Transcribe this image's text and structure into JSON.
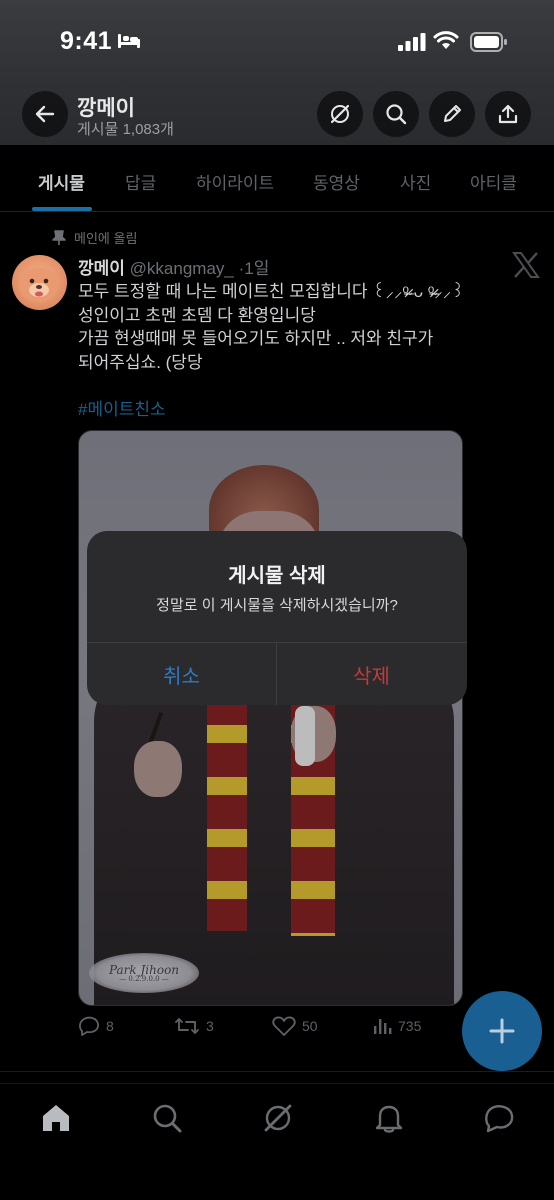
{
  "status_bar": {
    "time": "9:41"
  },
  "header": {
    "profile_name": "깡메이",
    "post_count": "게시물 1,083개"
  },
  "tabs": [
    {
      "label": "게시물",
      "active": true
    },
    {
      "label": "답글",
      "active": false
    },
    {
      "label": "하이라이트",
      "active": false
    },
    {
      "label": "동영상",
      "active": false
    },
    {
      "label": "사진",
      "active": false
    },
    {
      "label": "아티클",
      "active": false
    }
  ],
  "tweet": {
    "pinned_label": "메인에 올림",
    "display_name": "깡메이",
    "handle": "@kkangmay_",
    "time": "·1일",
    "text_lines": [
      "모두 트정할 때 나는 메이트친 모집합니다 ꒰⸝⸝ᵒ̴̶̷ ᴗ ᵒ̴̶̷⸝⸝꒱",
      "성인이고 초멘 초뎀 다 환영입니당",
      "가끔 현생때매 못 들어오기도 하지만 .. 저와 친구가",
      "되어주십쇼. (당당"
    ],
    "hashtag": "#메이트친소",
    "watermark_name": "Park Jihoon",
    "watermark_sub": "— 0.2.9.0.0 —",
    "replies": "8",
    "retweets": "3",
    "likes": "50",
    "views": "735"
  },
  "alert": {
    "title": "게시물 삭제",
    "message": "정말로 이 게시물을 삭제하시겠습니까?",
    "cancel_label": "취소",
    "delete_label": "삭제"
  },
  "colors": {
    "accent": "#1d9bf0",
    "alert_cancel": "#2f79c8",
    "alert_delete": "#c6393a"
  }
}
